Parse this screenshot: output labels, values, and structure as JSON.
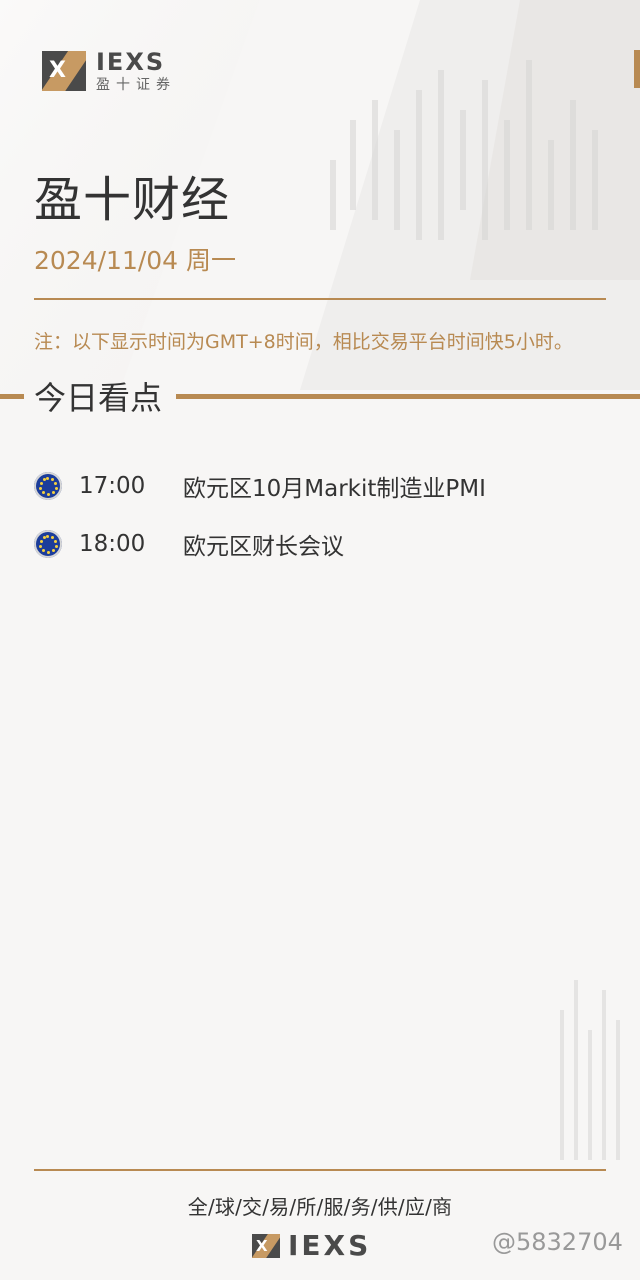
{
  "logo": {
    "brand": "IEXS",
    "subtitle": "盈十证券"
  },
  "title": "盈十财经",
  "date": "2024/11/04 周一",
  "note": "注：以下显示时间为GMT+8时间，相比交易平台时间快5小时。",
  "section": {
    "title": "今日看点"
  },
  "events": [
    {
      "time": "17:00",
      "title": "欧元区10月Markit制造业PMI",
      "flag_icon": "eu-flag-icon"
    },
    {
      "time": "18:00",
      "title": "欧元区财长会议",
      "flag_icon": "eu-flag-icon"
    }
  ],
  "footer": {
    "slogan": "全/球/交/易/所/服/务/供/应/商",
    "brand": "IEXS"
  },
  "watermark": "@5832704",
  "colors": {
    "accent": "#b88a52",
    "text": "#333333",
    "background": "#f7f6f5",
    "flag_blue": "#1c3d9a"
  }
}
